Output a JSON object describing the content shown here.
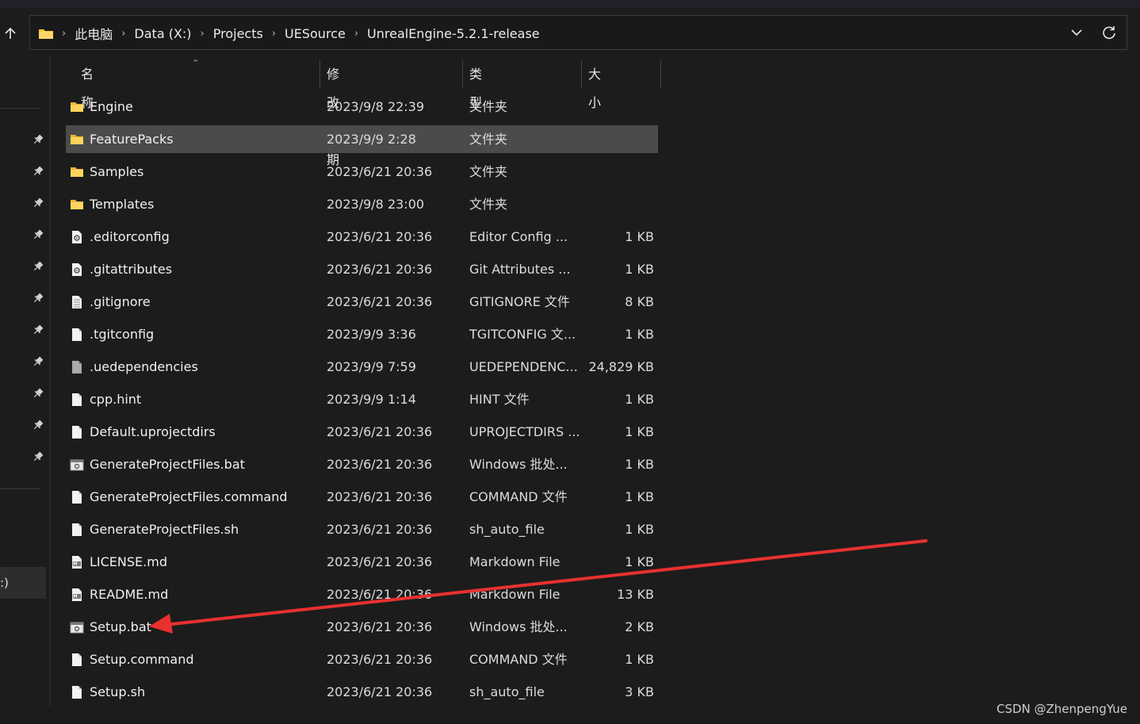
{
  "address": {
    "crumbs": [
      "此电脑",
      "Data (X:)",
      "Projects",
      "UESource",
      "UnrealEngine-5.2.1-release"
    ]
  },
  "nav": {
    "selected_label": ":)"
  },
  "columns": {
    "name": "名称",
    "date": "修改日期",
    "type": "类型",
    "size": "大小"
  },
  "files": [
    {
      "icon": "folder-icon",
      "name": "Engine",
      "date": "2023/9/8 22:39",
      "type": "文件夹",
      "size": ""
    },
    {
      "icon": "folder-icon",
      "name": "FeaturePacks",
      "date": "2023/9/9 2:28",
      "type": "文件夹",
      "size": "",
      "selected": true
    },
    {
      "icon": "folder-icon",
      "name": "Samples",
      "date": "2023/6/21 20:36",
      "type": "文件夹",
      "size": ""
    },
    {
      "icon": "folder-icon",
      "name": "Templates",
      "date": "2023/9/8 23:00",
      "type": "文件夹",
      "size": ""
    },
    {
      "icon": "config-file-icon",
      "name": ".editorconfig",
      "date": "2023/6/21 20:36",
      "type": "Editor Config ...",
      "size": "1 KB"
    },
    {
      "icon": "config-file-icon",
      "name": ".gitattributes",
      "date": "2023/6/21 20:36",
      "type": "Git Attributes ...",
      "size": "1 KB"
    },
    {
      "icon": "text-file-icon",
      "name": ".gitignore",
      "date": "2023/6/21 20:36",
      "type": "GITIGNORE 文件",
      "size": "8 KB"
    },
    {
      "icon": "file-icon",
      "name": ".tgitconfig",
      "date": "2023/9/9 3:36",
      "type": "TGITCONFIG 文...",
      "size": "1 KB"
    },
    {
      "icon": "grey-file-icon",
      "name": ".uedependencies",
      "date": "2023/9/9 7:59",
      "type": "UEDEPENDENC...",
      "size": "24,829 KB"
    },
    {
      "icon": "file-icon",
      "name": "cpp.hint",
      "date": "2023/9/9 1:14",
      "type": "HINT 文件",
      "size": "1 KB"
    },
    {
      "icon": "file-icon",
      "name": "Default.uprojectdirs",
      "date": "2023/6/21 20:36",
      "type": "UPROJECTDIRS ...",
      "size": "1 KB"
    },
    {
      "icon": "batch-file-icon",
      "name": "GenerateProjectFiles.bat",
      "date": "2023/6/21 20:36",
      "type": "Windows 批处...",
      "size": "1 KB"
    },
    {
      "icon": "file-icon",
      "name": "GenerateProjectFiles.command",
      "date": "2023/6/21 20:36",
      "type": "COMMAND 文件",
      "size": "1 KB"
    },
    {
      "icon": "file-icon",
      "name": "GenerateProjectFiles.sh",
      "date": "2023/6/21 20:36",
      "type": "sh_auto_file",
      "size": "1 KB"
    },
    {
      "icon": "markdown-file-icon",
      "name": "LICENSE.md",
      "date": "2023/6/21 20:36",
      "type": "Markdown File",
      "size": "1 KB"
    },
    {
      "icon": "markdown-file-icon",
      "name": "README.md",
      "date": "2023/6/21 20:36",
      "type": "Markdown File",
      "size": "13 KB"
    },
    {
      "icon": "batch-file-icon",
      "name": "Setup.bat",
      "date": "2023/6/21 20:36",
      "type": "Windows 批处...",
      "size": "2 KB"
    },
    {
      "icon": "file-icon",
      "name": "Setup.command",
      "date": "2023/6/21 20:36",
      "type": "COMMAND 文件",
      "size": "1 KB"
    },
    {
      "icon": "file-icon",
      "name": "Setup.sh",
      "date": "2023/6/21 20:36",
      "type": "sh_auto_file",
      "size": "3 KB"
    }
  ],
  "watermark": "CSDN @ZhenpengYue",
  "colors": {
    "selection": "#4b4b4b",
    "folder": "#f5c542",
    "annotation_arrow": "#e8312f"
  }
}
